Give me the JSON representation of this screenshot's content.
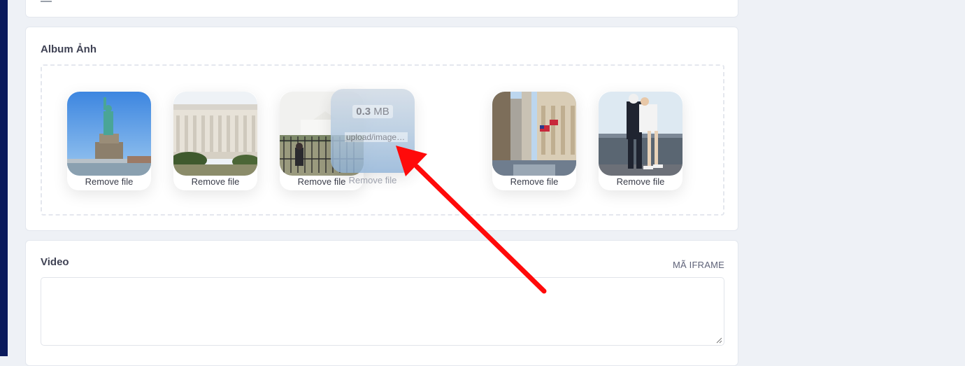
{
  "album": {
    "title": "Album Ảnh",
    "thumbnails": [
      {
        "icon": "statue-of-liberty-photo",
        "remove_label": "Remove file"
      },
      {
        "icon": "lincoln-memorial-photo",
        "remove_label": "Remove file"
      },
      {
        "icon": "white-house-photo",
        "remove_label": "Remove file"
      },
      {
        "icon": "wall-street-photo",
        "remove_label": "Remove file"
      },
      {
        "icon": "kissing-sailor-statue-photo",
        "remove_label": "Remove file"
      }
    ],
    "dragging": {
      "size_value": "0.3",
      "size_unit": "MB",
      "filename": "upload/image.jpg",
      "remove_label": "Remove file"
    }
  },
  "video": {
    "title": "Video",
    "iframe_label": "MÃ IFRAME",
    "textarea_value": ""
  },
  "colors": {
    "left_rail": "#0a1a5c",
    "page_bg": "#eef1f6",
    "arrow": "#ff0a0a"
  }
}
